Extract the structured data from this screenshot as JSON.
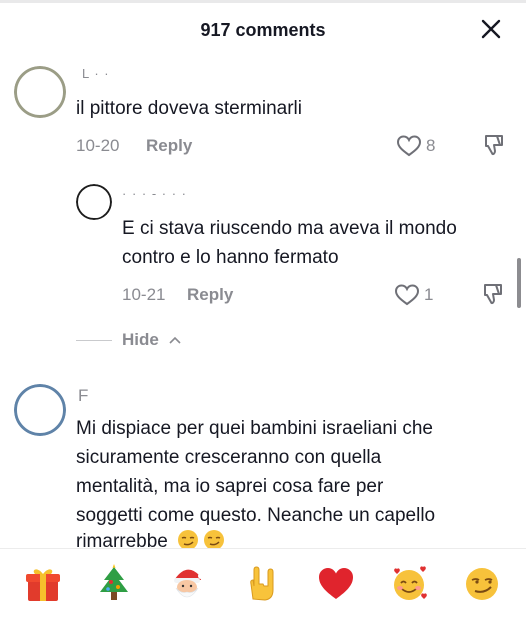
{
  "header": {
    "title": "917 comments",
    "close_icon": "close-icon"
  },
  "comments": [
    {
      "username": "L  ·  ·",
      "text": "il pittore doveva sterminarli",
      "date": "10-20",
      "reply_label": "Reply",
      "likes": "8"
    },
    {
      "username": "· · · - · · ·",
      "text_line1": "E ci stava riuscendo ma aveva il mondo",
      "text_line2": "contro e lo hanno fermato",
      "date": "10-21",
      "reply_label": "Reply",
      "likes": "1"
    },
    {
      "username": "F",
      "text_lines": [
        "Mi dispiace per quei bambini israeliani che",
        "sicuramente cresceranno con quella",
        "mentalità, ma io saprei cosa fare per",
        "soggetti come questo. Neanche un capello",
        "rimarrebbe"
      ]
    }
  ],
  "hide_label": "Hide",
  "emoji_bar": [
    "gift-emoji",
    "christmas-tree-emoji",
    "santa-emoji",
    "rock-on-hand-emoji",
    "red-heart-emoji",
    "smiling-face-with-hearts-emoji",
    "smirking-face-emoji"
  ],
  "colors": {
    "text": "#161823",
    "secondary": "#8a8b91",
    "heart_red": "#e0242d"
  }
}
